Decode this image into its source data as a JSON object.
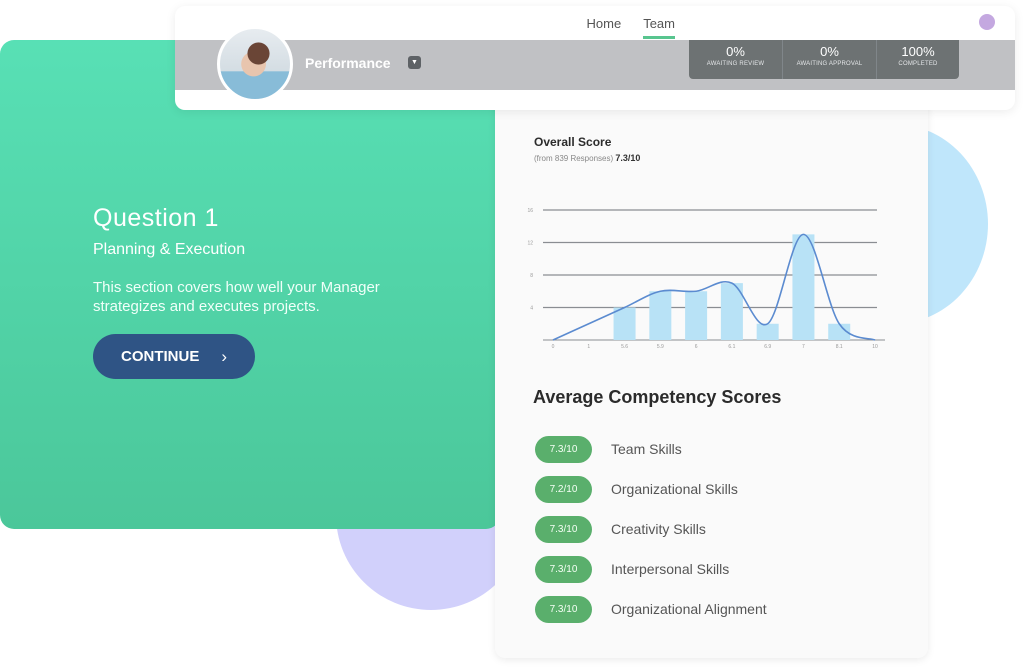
{
  "nav": {
    "items": [
      {
        "label": "Home",
        "active": false
      },
      {
        "label": "Team",
        "active": true
      }
    ]
  },
  "header": {
    "section_label": "Performance",
    "dropdown_icon": "caret-down-icon",
    "stats": [
      {
        "value": "0%",
        "label": "AWAITING REVIEW"
      },
      {
        "value": "0%",
        "label": "AWAITING APPROVAL"
      },
      {
        "value": "100%",
        "label": "COMPLETED"
      }
    ]
  },
  "question": {
    "title": "Question 1",
    "subtitle": "Planning & Execution",
    "description": "This section covers how well your Manager strategizes and executes projects.",
    "continue_label": "CONTINUE",
    "continue_icon": "›"
  },
  "overall": {
    "title": "Overall Score",
    "responses_text": "(from 839 Responses)",
    "score": "7.3/10"
  },
  "chart_data": {
    "type": "bar",
    "title": "Overall Score",
    "categories": [
      "0",
      "1",
      "5.6",
      "5.9",
      "6",
      "6.1",
      "6.9",
      "7",
      "8.1",
      "10"
    ],
    "values": [
      0,
      0,
      4,
      6,
      6,
      7,
      2,
      13,
      2,
      0
    ],
    "curve": [
      0,
      2,
      4,
      6,
      6,
      7,
      2,
      13,
      2,
      0
    ],
    "yticks": [
      4,
      8,
      12,
      16
    ],
    "ylim": [
      0,
      16
    ],
    "grid": true,
    "xlabel": "",
    "ylabel": "",
    "colors": {
      "bar": "#b8e2f6",
      "line": "#5b8bd0"
    }
  },
  "competencies": {
    "title": "Average Competency Scores",
    "items": [
      {
        "score": "7.3/10",
        "label": "Team Skills"
      },
      {
        "score": "7.2/10",
        "label": "Organizational Skills"
      },
      {
        "score": "7.3/10",
        "label": "Creativity Skills"
      },
      {
        "score": "7.3/10",
        "label": "Interpersonal Skills"
      },
      {
        "score": "7.3/10",
        "label": "Organizational Alignment"
      }
    ]
  }
}
